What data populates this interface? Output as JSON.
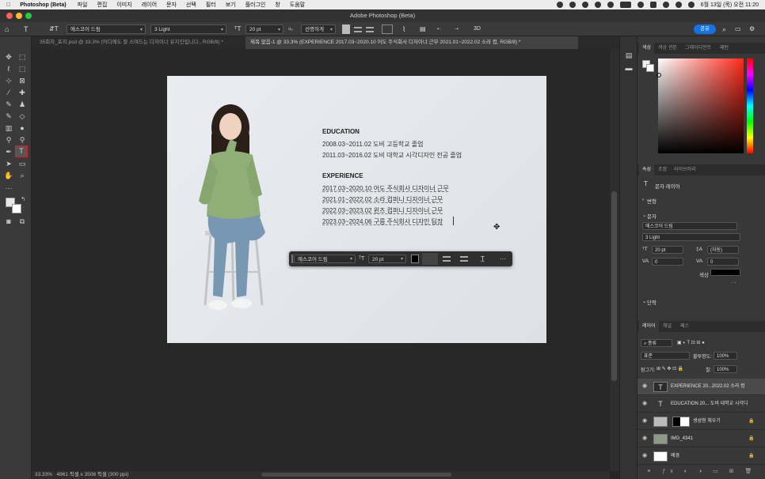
{
  "menubar": {
    "app": "Photoshop (Beta)",
    "items": [
      "파일",
      "편집",
      "이미지",
      "레이어",
      "문자",
      "선택",
      "필터",
      "보기",
      "플러그인",
      "창",
      "도움말"
    ],
    "clock": "6월 13일 (목) 오전 11:20"
  },
  "window": {
    "title": "Adobe Photoshop (Beta)"
  },
  "options": {
    "font_family": "에스코어 드림",
    "font_style": "3 Light",
    "font_size": "20 pt",
    "antialias": "선명하게",
    "share_label": "공유",
    "text_color": "#000000"
  },
  "tabs": [
    {
      "label": "35회차_포지.psd @ 33.3% (어디에도 잘 스며드는 디자이너 유지인입니다., RGB/8) *",
      "active": false
    },
    {
      "label": "제목 없음-1 @ 33.3% (EXPERIENCE 2017.03~2020.10 어도 주식회사 디자이너 근무 2021.01~2022.02 소라 컴, RGB/8) *",
      "active": true
    }
  ],
  "document": {
    "education_title": "EDUCATION",
    "education_lines": [
      "2008.03~2011.02 도비 고등학교 졸업",
      "2011.03~2016.02 도비 대학교 시각디자인 전공 졸업"
    ],
    "experience_title": "EXPERIENCE",
    "experience_lines": [
      "2017.03~2020.10 어도 주식회사 디자이너 근무",
      "2021.01~2022.02 소라 컴퍼니 디자이너 근무",
      "2022.03~2023.02 윈즈 컴퍼니 디자이너 근무",
      "2023.03~2024.06 구름 주식회사 디자인 팀장"
    ]
  },
  "context_bar": {
    "font_family": "에스코어 드림",
    "font_size": "20 pt"
  },
  "status": {
    "zoom": "33.33%",
    "size": "4961 픽셀 x 3508 픽셀 (300 ppi)"
  },
  "color_panel": {
    "tabs": [
      "색상",
      "색상 견본",
      "그레이디언트",
      "패턴"
    ],
    "hue_color": "#ff2a1a"
  },
  "properties_panel": {
    "tabs": [
      "속성",
      "조정",
      "라이브러리"
    ],
    "layer_type": "문자 레이어",
    "transform_label": "변형",
    "type_label": "문자",
    "font_family": "에스코어 드림",
    "font_style": "3 Light",
    "font_size": "20 pt",
    "leading": "(자동)",
    "kerning": "0",
    "tracking": "0",
    "color_label": "색상",
    "paragraph_label": "단락"
  },
  "layers_panel": {
    "tabs": [
      "레이어",
      "채널",
      "패스"
    ],
    "filter_label": "종류",
    "blend_mode": "표준",
    "opacity_label": "불투명도:",
    "opacity": "100%",
    "lock_label": "잠그기:",
    "fill_label": "칠:",
    "fill": "100%",
    "layers": [
      {
        "name": "EXPERIENCE 20...2022.02 소라 컴",
        "kind": "text",
        "selected": true
      },
      {
        "name": "EDUCATION 20... 도비 대학교 시각디",
        "kind": "text",
        "selected": false
      },
      {
        "name": "생성형 채우기",
        "kind": "fill",
        "selected": false
      },
      {
        "name": "IMG_4341",
        "kind": "image",
        "selected": false
      },
      {
        "name": "배경",
        "kind": "background",
        "selected": false
      }
    ]
  }
}
